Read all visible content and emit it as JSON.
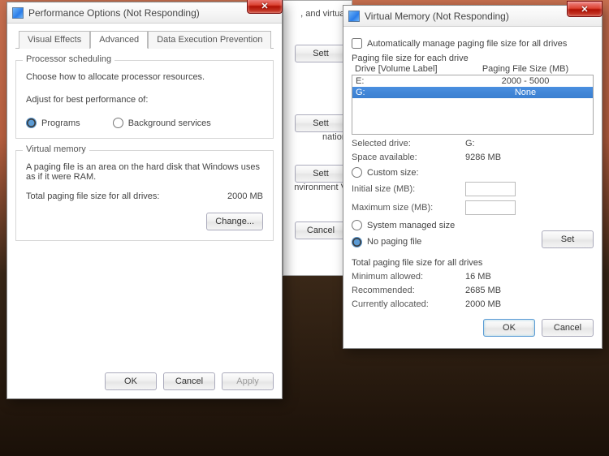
{
  "bg": {
    "virtual_text": ", and virtual",
    "btn": "Sett",
    "info_label": "nation",
    "env_label": "nvironment V",
    "cancel": "Cancel"
  },
  "perf": {
    "title": "Performance Options (Not Responding)",
    "tabs": {
      "visual": "Visual Effects",
      "advanced": "Advanced",
      "dep": "Data Execution Prevention"
    },
    "sched": {
      "title": "Processor scheduling",
      "desc": "Choose how to allocate processor resources.",
      "adjust": "Adjust for best performance of:",
      "programs": "Programs",
      "bg": "Background services"
    },
    "vm": {
      "title": "Virtual memory",
      "desc": "A paging file is an area on the hard disk that Windows uses as if it were RAM.",
      "total_label": "Total paging file size for all drives:",
      "total_value": "2000 MB",
      "change": "Change..."
    },
    "ok": "OK",
    "cancel": "Cancel",
    "apply": "Apply"
  },
  "vm": {
    "title": "Virtual Memory (Not Responding)",
    "auto": "Automatically manage paging file size for all drives",
    "each": "Paging file size for each drive",
    "hdr_drive": "Drive  [Volume Label]",
    "hdr_size": "Paging File Size (MB)",
    "rows": [
      {
        "drive": "E:",
        "size": "2000 - 5000"
      },
      {
        "drive": "G:",
        "size": "None"
      }
    ],
    "sel_label": "Selected drive:",
    "sel_value": "G:",
    "avail_label": "Space available:",
    "avail_value": "9286 MB",
    "custom": "Custom size:",
    "init": "Initial size (MB):",
    "max": "Maximum size (MB):",
    "sysman": "System managed size",
    "nopage": "No paging file",
    "set": "Set",
    "totals_title": "Total paging file size for all drives",
    "min_label": "Minimum allowed:",
    "min_value": "16 MB",
    "rec_label": "Recommended:",
    "rec_value": "2685 MB",
    "cur_label": "Currently allocated:",
    "cur_value": "2000 MB",
    "ok": "OK",
    "cancel": "Cancel"
  }
}
